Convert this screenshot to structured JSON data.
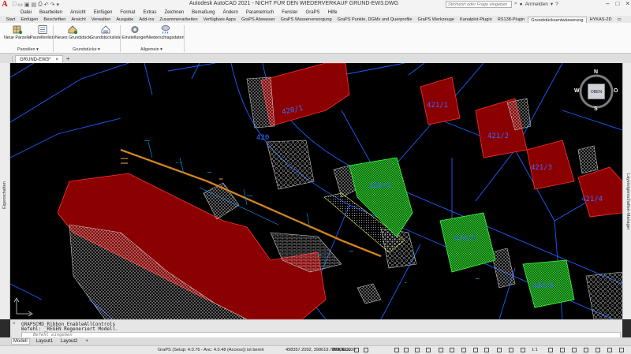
{
  "window": {
    "title": "Autodesk AutoCAD 2021 - NICHT FÜR DEN WIEDERVERKAUF   GRUND-EW3.DWG",
    "search_placeholder": "Stichwort oder Frage eingeben",
    "user_label": "Anmelden",
    "app_logo": "A",
    "logo_color": "#d40000"
  },
  "menu": [
    "Datei",
    "Bearbeiten",
    "Ansicht",
    "Einfügen",
    "Format",
    "Extras",
    "Zeichnen",
    "Bemaßung",
    "Ändern",
    "Parametrisch",
    "Fenster",
    "GraPS",
    "Hilfe"
  ],
  "ribbon_tabs": [
    "Start",
    "Einfügen",
    "Beschriften",
    "Ansicht",
    "Verwalten",
    "Ausgabe",
    "Add-ins",
    "Zusammenarbeiten",
    "Verfügbare Apps",
    "GraPS Abwasser",
    "GraPS Wasserversorgung",
    "GraPS Punkte, DGMs und Querprofile",
    "GraPS Werkzeuge",
    "Kanalplot-Plugin",
    "RS138-Plugin",
    "Grundstücksentwässerung",
    "HYKAS-2D"
  ],
  "ribbon_active_tab_index": 15,
  "ribbon": {
    "buttons": [
      {
        "label": "Neue Parzelle",
        "icon": "new-parcel-icon"
      },
      {
        "label": "Parzellenliste",
        "icon": "parcel-list-icon"
      },
      {
        "label": "Neues Grundstück",
        "icon": "new-property-icon"
      },
      {
        "label": "Grundstücksliste",
        "icon": "property-list-icon"
      },
      {
        "label": "Einstellungen",
        "icon": "settings-icon"
      },
      {
        "label": "Niederschlagsdaten",
        "icon": "precipitation-icon"
      }
    ],
    "panels": [
      "Parzellen ▾",
      "Grundstücke ▾",
      "Allgemein ▾"
    ]
  },
  "doc_tabs": {
    "active": "GRUND-EW3*",
    "close": "×",
    "add": "+"
  },
  "side_panels": {
    "left": "Eigenschaften",
    "right": "Layereigenschaften-Manager"
  },
  "viewcube": {
    "top_label": "OBEN",
    "n": "N",
    "s": "S",
    "e": "O",
    "w": "W"
  },
  "drawing": {
    "parcel_labels": [
      "420/1",
      "420",
      "421/1",
      "421/2",
      "421/3",
      "421/4",
      "420/4",
      "420/2",
      "420/6"
    ],
    "colors": {
      "building": "#8b0000",
      "building_outline": "#ff3030",
      "green_area": "#0b7a0b",
      "green_outline": "#3cff3c",
      "parcel_line": "#1e5fff",
      "pipe": "#c87a1e",
      "hatch": "#c8c8c8",
      "annotation": "#00a8ff",
      "label": "#3b6bff"
    }
  },
  "cmd": {
    "history": [
      "GRAPSCMD_Ribbon_EnableAllControls",
      "Befehl: _REGEN Regeneriert Modell."
    ],
    "prompt_placeholder": "Befehl eingeben"
  },
  "layout_tabs": [
    "Modell",
    "Layout1",
    "Layout2",
    "+"
  ],
  "layout_active_index": 0,
  "status": {
    "app_info": "GraPS (Setup: 4.0.76 - Anc: 4.0.48 (Access)) ist bereit",
    "coords": "498357.2092, 398619.7374, 0.0000",
    "mode": "MODELL",
    "scale": "1:1"
  }
}
